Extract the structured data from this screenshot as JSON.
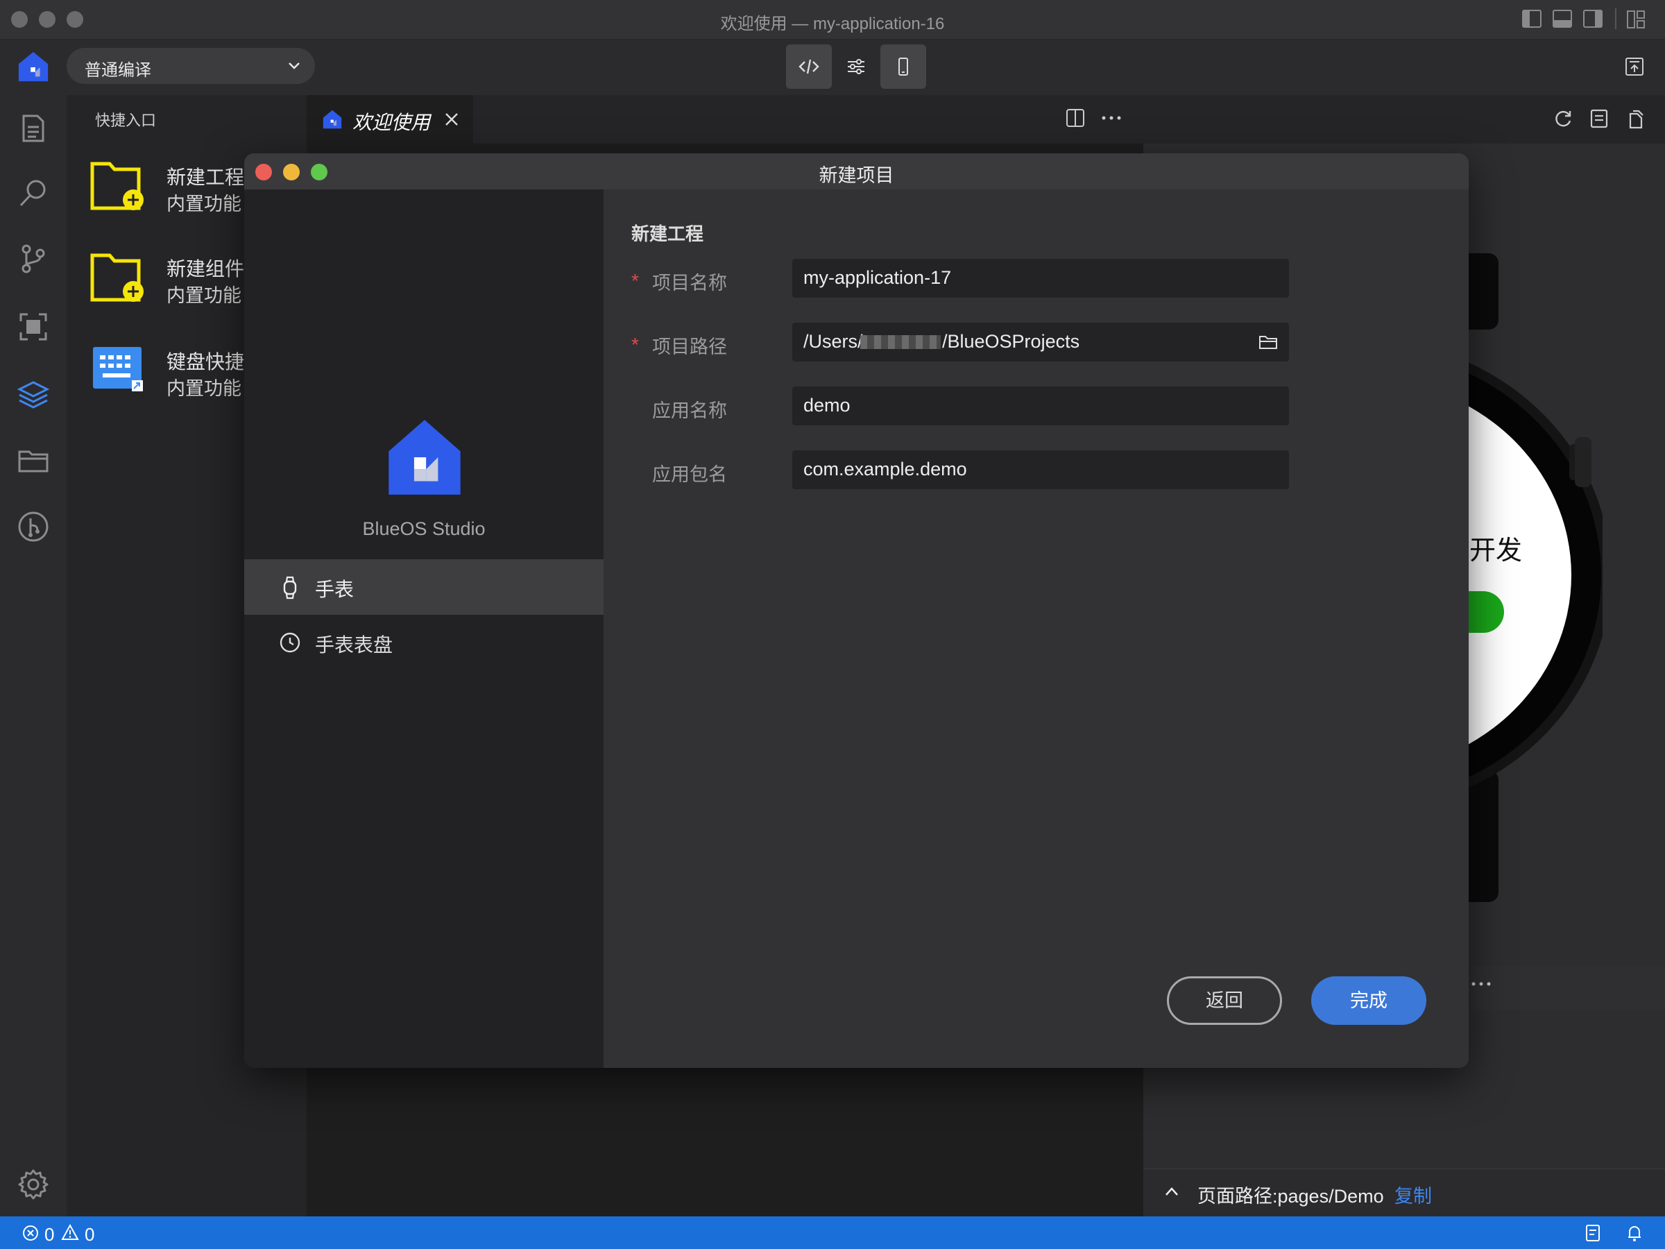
{
  "window": {
    "title": "欢迎使用 — my-application-16"
  },
  "toolbar": {
    "compile_mode": "普通编译"
  },
  "sidebar": {
    "title": "快捷入口",
    "items": [
      {
        "title": "新建工程",
        "subtitle": "内置功能",
        "icon": "folder-add-icon"
      },
      {
        "title": "新建组件",
        "subtitle": "内置功能",
        "icon": "folder-add-icon"
      },
      {
        "title": "键盘快捷",
        "subtitle": "内置功能",
        "icon": "keyboard-icon"
      }
    ]
  },
  "editor": {
    "active_tab": "欢迎使用"
  },
  "preview": {
    "watch_text": "开发",
    "page_path": "页面路径:pages/Demo",
    "copy_label": "复制"
  },
  "statusbar": {
    "errors": "0",
    "warnings": "0"
  },
  "dialog": {
    "title": "新建项目",
    "brand": "BlueOS Studio",
    "categories": [
      {
        "label": "手表",
        "icon": "watch-icon",
        "selected": true
      },
      {
        "label": "手表表盘",
        "icon": "clock-icon",
        "selected": false
      }
    ],
    "section_title": "新建工程",
    "fields": [
      {
        "label": "项目名称",
        "required": true,
        "value": "my-application-17"
      },
      {
        "label": "项目路径",
        "required": true,
        "value_prefix": "/Users/",
        "value_suffix": "/BlueOSProjects"
      },
      {
        "label": "应用名称",
        "required": false,
        "value": "demo"
      },
      {
        "label": "应用包名",
        "required": false,
        "value": "com.example.demo"
      }
    ],
    "back_label": "返回",
    "done_label": "完成",
    "required_mark": "*"
  },
  "colors": {
    "accent": "#3c78d8",
    "statusbar": "#1b6fd8",
    "required": "#e04b4b",
    "folder_yellow": "#f5e50a"
  }
}
